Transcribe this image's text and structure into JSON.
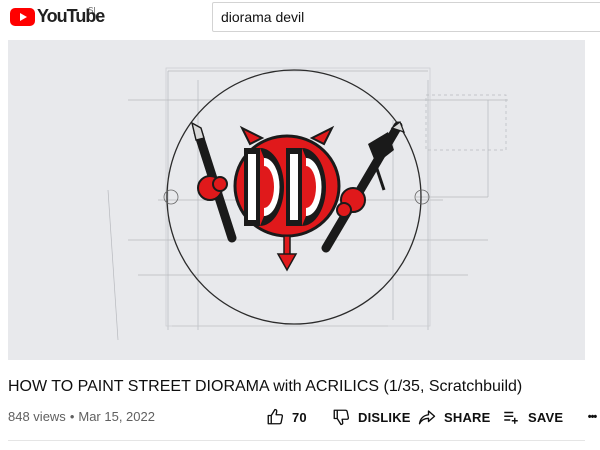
{
  "header": {
    "logo_text": "YouTube",
    "region": "SI",
    "search": {
      "value": "diorama devil"
    }
  },
  "video": {
    "thumbnail": "diorama-devil-logo",
    "colors": {
      "accent": "#e0191b",
      "background": "#e8e9ec"
    }
  },
  "info": {
    "title": "HOW TO PAINT STREET DIORAMA with ACRILICS (1/35, Scratchbuild)",
    "views": "848 views",
    "date": "Mar 15, 2022"
  },
  "actions": {
    "like_count": "70",
    "dislike_label": "DISLIKE",
    "share_label": "SHARE",
    "save_label": "SAVE",
    "more_label": "•••"
  }
}
